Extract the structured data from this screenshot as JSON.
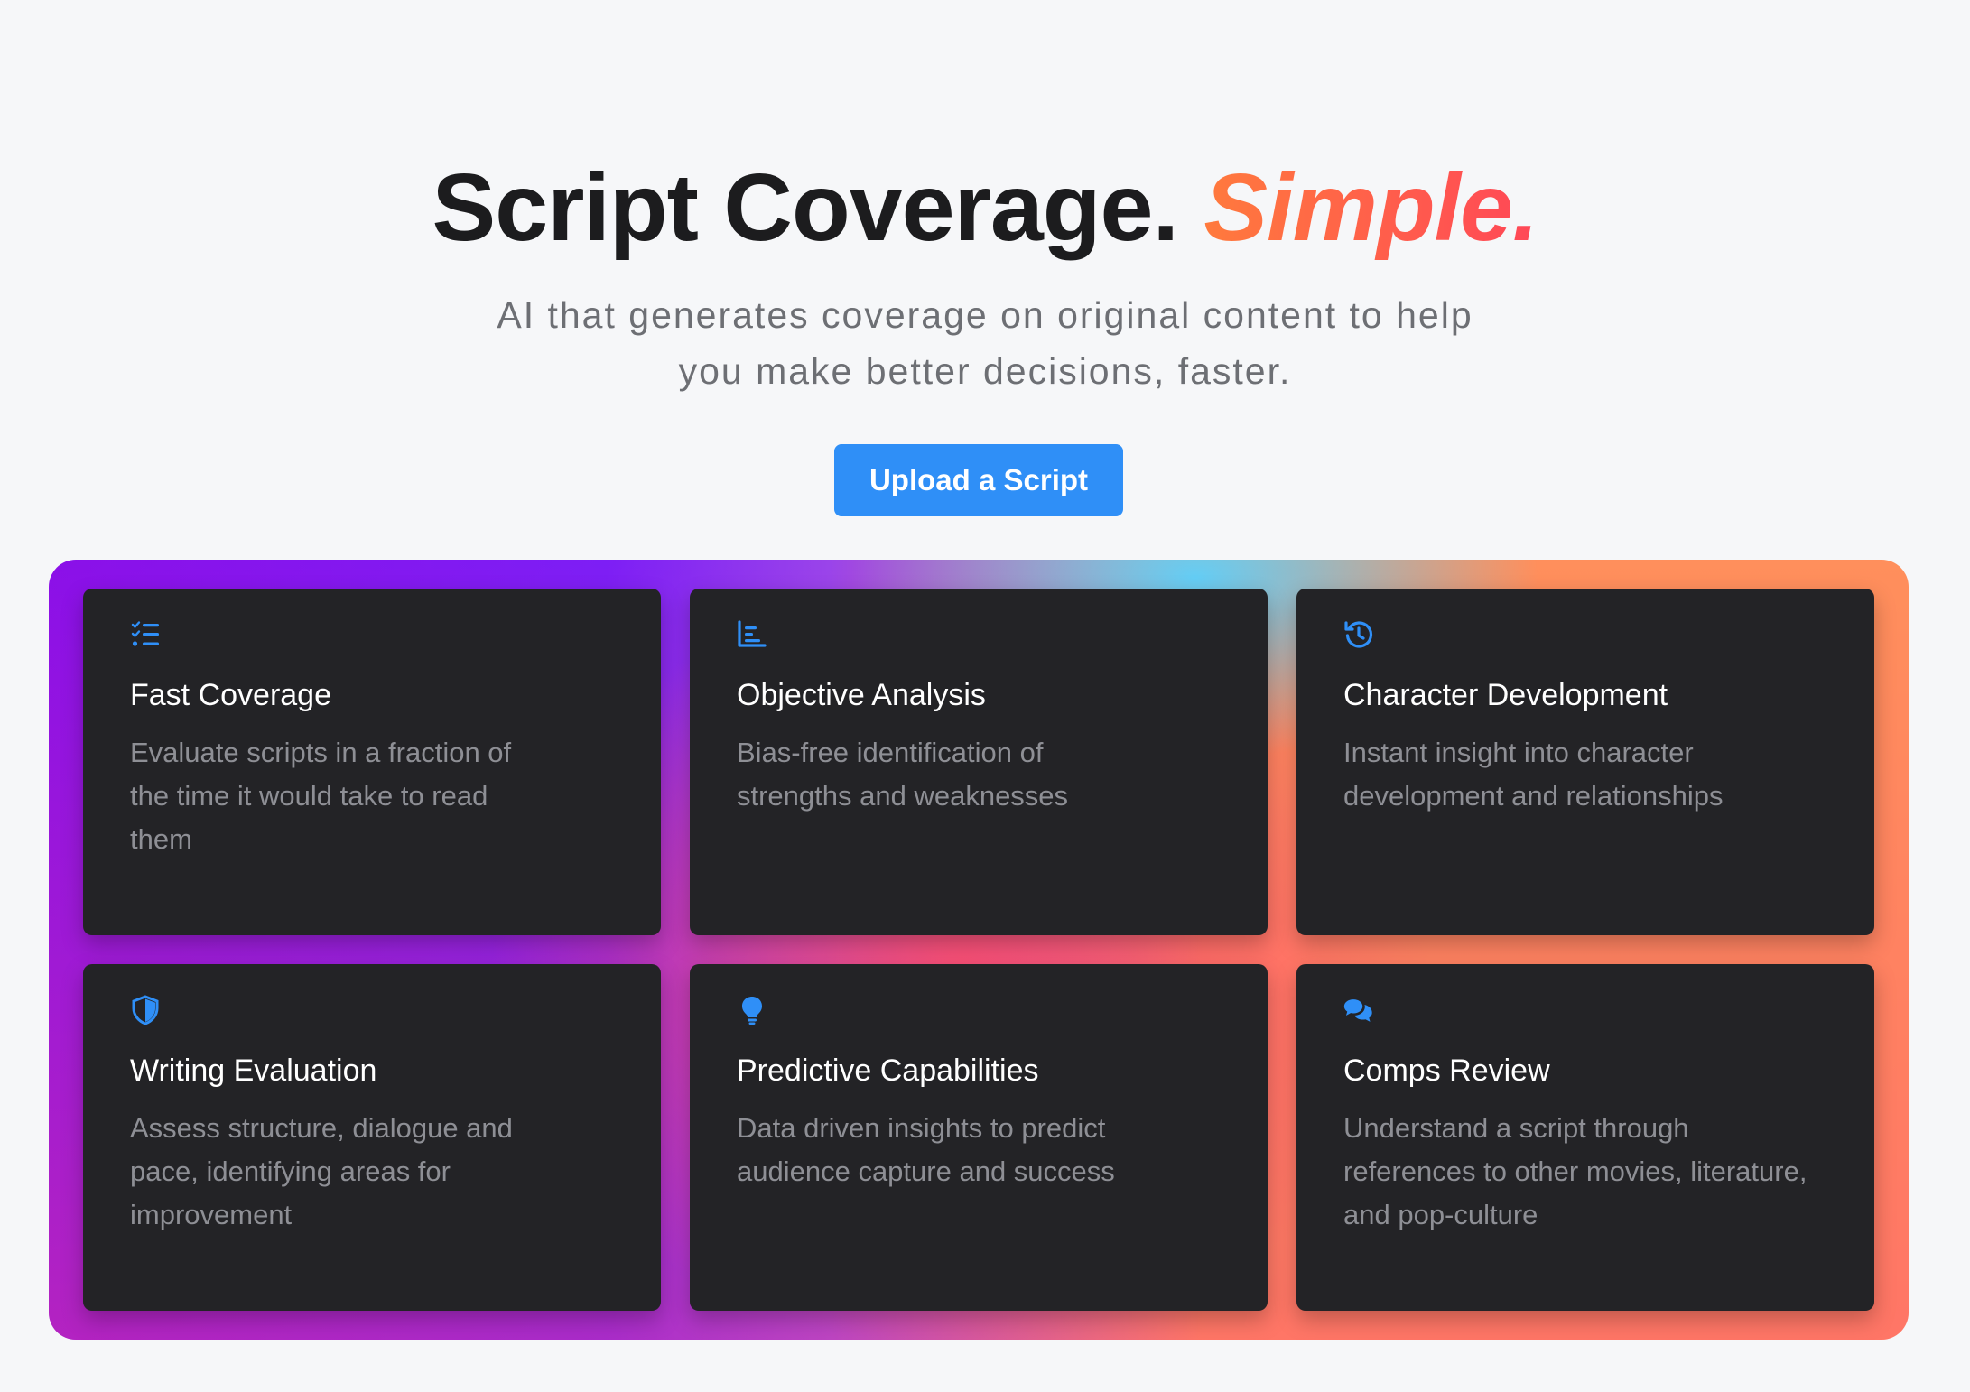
{
  "hero": {
    "headline_main": "Script Coverage.",
    "headline_accent": "Simple.",
    "subtitle": "AI that generates coverage on original content to help you make better decisions, faster.",
    "cta_label": "Upload a Script"
  },
  "colors": {
    "background": "#f6f7f9",
    "cta": "#2f8ff7",
    "card": "#232326",
    "icon": "#2f8ff7",
    "accent_start": "#ff7a3d",
    "accent_end": "#ff4757"
  },
  "features": [
    {
      "icon": "checklist-icon",
      "title": "Fast Coverage",
      "description": "Evaluate scripts in a fraction of the time it would take to read them"
    },
    {
      "icon": "bar-chart-icon",
      "title": "Objective Analysis",
      "description": "Bias-free identification of strengths and weaknesses"
    },
    {
      "icon": "history-icon",
      "title": "Character Development",
      "description": "Instant insight into character development and relationships"
    },
    {
      "icon": "shield-icon",
      "title": "Writing Evaluation",
      "description": "Assess structure, dialogue and pace, identifying areas for improvement"
    },
    {
      "icon": "lightbulb-icon",
      "title": "Predictive Capabilities",
      "description": "Data driven insights to predict audience capture and success"
    },
    {
      "icon": "chat-bubbles-icon",
      "title": "Comps Review",
      "description": "Understand a script through references to other movies, literature, and pop-culture"
    }
  ]
}
